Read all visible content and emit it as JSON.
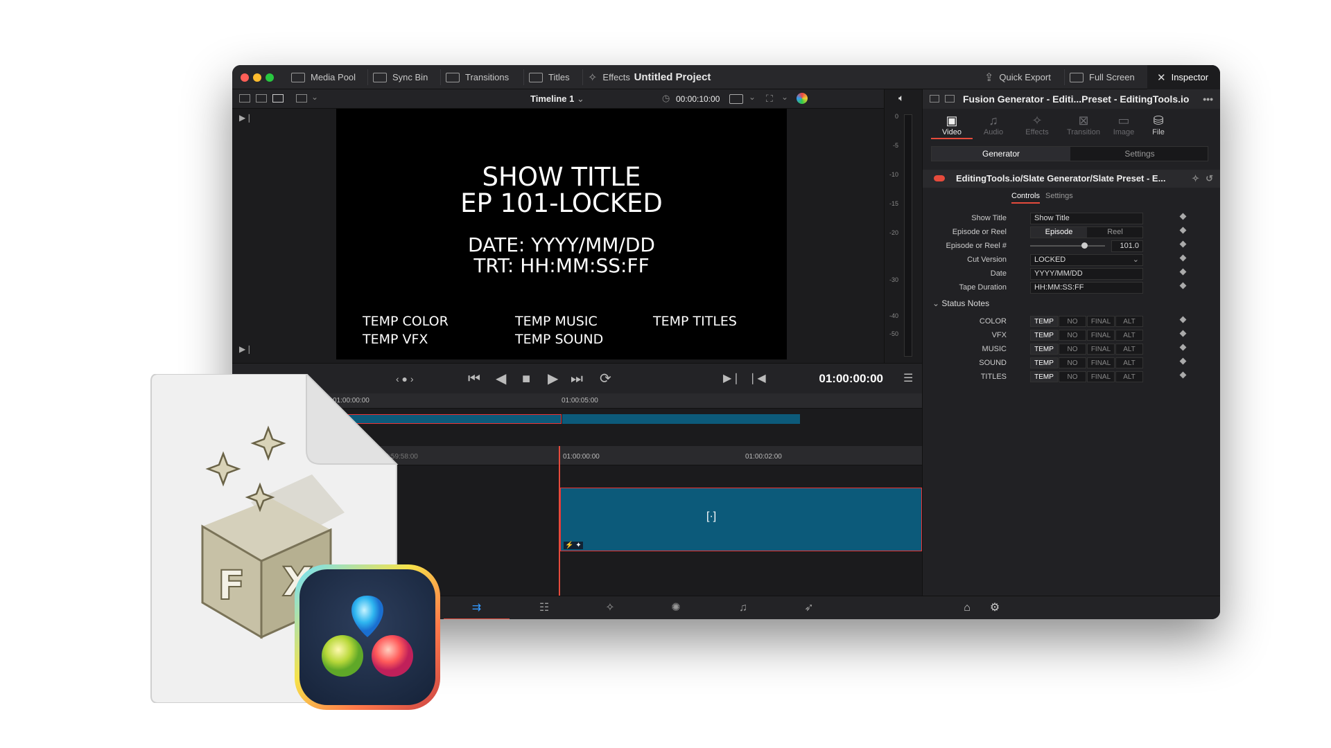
{
  "window": {
    "title": "Untitled Project",
    "toolbar": {
      "media_pool": "Media Pool",
      "sync_bin": "Sync Bin",
      "transitions": "Transitions",
      "titles": "Titles",
      "effects": "Effects",
      "quick_export": "Quick Export",
      "full_screen": "Full Screen",
      "inspector": "Inspector"
    }
  },
  "viewer": {
    "timeline_name": "Timeline 1",
    "duration": "00:00:10:00",
    "timecode": "01:00:00:00",
    "slate": {
      "line1": "SHOW TITLE",
      "line2": "EP 101-LOCKED",
      "line3": "DATE: YYYY/MM/DD",
      "line4": "TRT: HH:MM:SS:FF",
      "col1a": "TEMP COLOR",
      "col1b": "TEMP VFX",
      "col2a": "TEMP MUSIC",
      "col2b": "TEMP SOUND",
      "col3a": "TEMP TITLES"
    },
    "meter_ticks": [
      "0",
      "-5",
      "-10",
      "-15",
      "-20",
      "-30",
      "-40",
      "-50"
    ]
  },
  "timeline": {
    "upper_ruler": [
      "01:00:00:00",
      "01:00:05:00"
    ],
    "lower_ruler": [
      "00:59:58:00",
      "01:00:00:00",
      "01:00:02:00"
    ],
    "clip_label": "[·]"
  },
  "inspector": {
    "header": "Fusion Generator - Editi...Preset - EditingTools.io",
    "tabs": [
      "Video",
      "Audio",
      "Effects",
      "Transition",
      "Image",
      "File"
    ],
    "segments": [
      "Generator",
      "Settings"
    ],
    "effect_name": "EditingTools.io/Slate Generator/Slate Preset - E...",
    "subtabs": [
      "Controls",
      "Settings"
    ],
    "params": {
      "show_title_label": "Show Title",
      "show_title_value": "Show Title",
      "episode_or_reel_label": "Episode or Reel",
      "episode_btn": "Episode",
      "reel_btn": "Reel",
      "episode_num_label": "Episode or Reel #",
      "episode_num_value": "101.0",
      "cut_version_label": "Cut Version",
      "cut_version_value": "LOCKED",
      "date_label": "Date",
      "date_value": "YYYY/MM/DD",
      "tape_duration_label": "Tape Duration",
      "tape_duration_value": "HH:MM:SS:FF"
    },
    "status_notes_label": "Status Notes",
    "status_rows": [
      "COLOR",
      "VFX",
      "MUSIC",
      "SOUND",
      "TITLES"
    ],
    "status_options": [
      "TEMP",
      "NO",
      "FINAL",
      "ALT"
    ]
  },
  "colors": {
    "accent": "#e64b3c",
    "clip": "#0c5a7a",
    "window_bg": "#1f1f22"
  }
}
